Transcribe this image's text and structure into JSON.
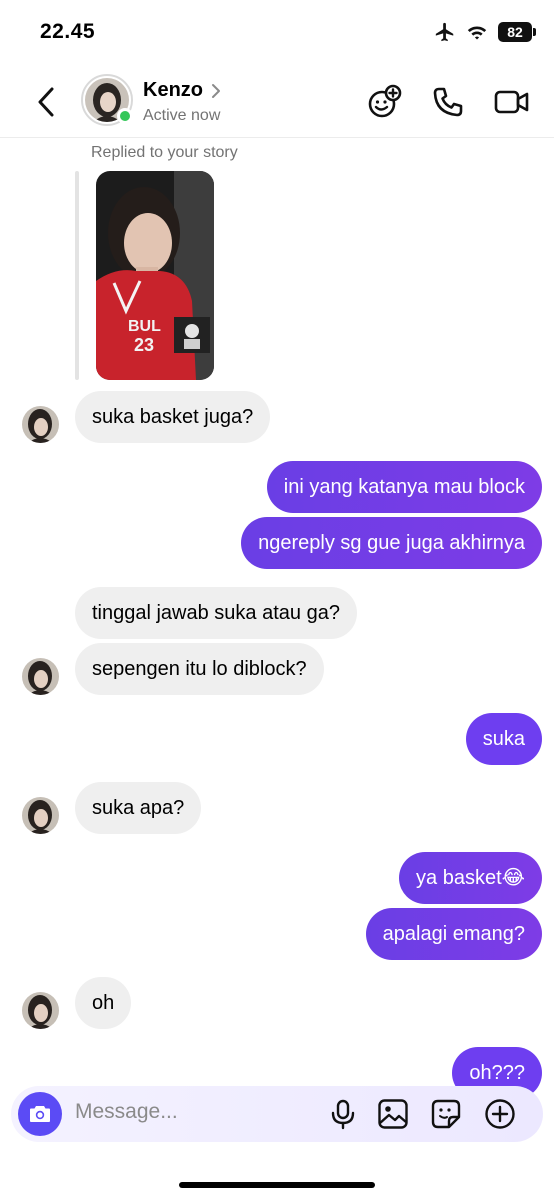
{
  "status_bar": {
    "time": "22.45",
    "battery": "82"
  },
  "header": {
    "name": "Kenzo",
    "status": "Active now"
  },
  "story_reply": {
    "label": "Replied to your story"
  },
  "messages": [
    {
      "from": "them",
      "text": "suka basket juga?"
    },
    {
      "from": "me",
      "text": "ini yang katanya mau block"
    },
    {
      "from": "me",
      "text": "ngereply sg gue juga akhirnya"
    },
    {
      "from": "them",
      "text": "tinggal jawab suka atau ga?"
    },
    {
      "from": "them",
      "text": "sepengen itu lo diblock?"
    },
    {
      "from": "me",
      "text": "suka"
    },
    {
      "from": "them",
      "text": "suka apa?"
    },
    {
      "from": "me",
      "text": "ya basket😂"
    },
    {
      "from": "me",
      "text": "apalagi emang?"
    },
    {
      "from": "them",
      "text": "oh"
    },
    {
      "from": "me",
      "text": "oh???"
    }
  ],
  "composer": {
    "placeholder": "Message..."
  },
  "icons": [
    "back-icon",
    "chevron-right-icon",
    "game-controller-icon",
    "phone-icon",
    "video-camera-icon",
    "camera-icon",
    "microphone-icon",
    "gallery-icon",
    "sticker-icon",
    "plus-icon",
    "airplane-icon",
    "wifi-icon"
  ]
}
